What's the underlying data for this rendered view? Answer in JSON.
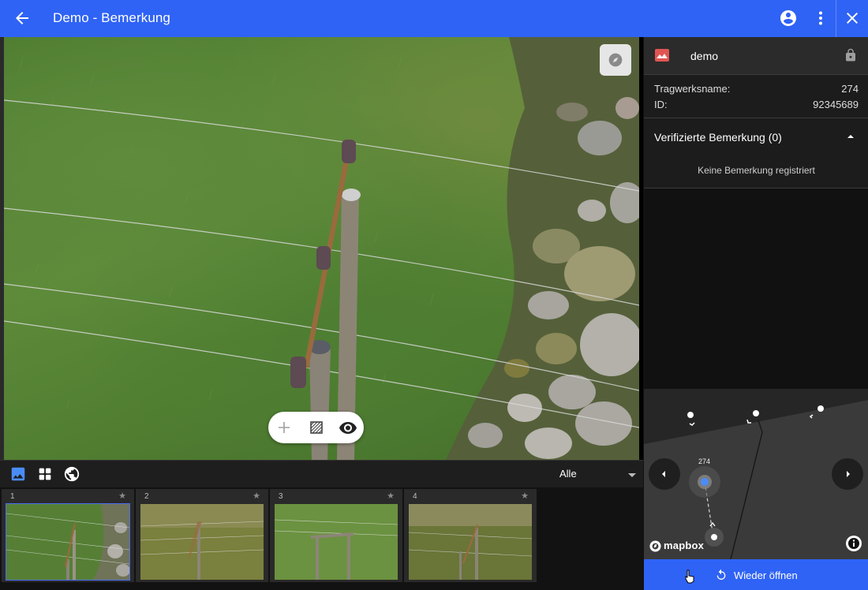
{
  "header": {
    "title": "Demo - Bemerkung",
    "back_icon": "arrow-left-icon",
    "account_icon": "account-circle-icon",
    "more_icon": "more-vertical-icon",
    "close_icon": "close-icon",
    "accent": "#2f63f5"
  },
  "viewer": {
    "compass_icon": "compass-icon",
    "tools": [
      "plus-icon",
      "hatch-pattern-icon",
      "eye-icon"
    ]
  },
  "gallery": {
    "view_icons": [
      "image-icon",
      "grid-icon",
      "globe-icon"
    ],
    "filter_value": "Alle",
    "thumbnails": [
      {
        "number": "1",
        "star": "★",
        "selected": true
      },
      {
        "number": "2",
        "star": "★",
        "selected": false
      },
      {
        "number": "3",
        "star": "★",
        "selected": false
      },
      {
        "number": "4",
        "star": "★",
        "selected": false
      }
    ]
  },
  "panel": {
    "project_name": "demo",
    "project_icon": "image-landscape-icon",
    "lock_icon": "lock-icon",
    "info": [
      {
        "label": "Tragwerksname:",
        "value": "274"
      },
      {
        "label": "ID:",
        "value": "92345689"
      }
    ],
    "section_title": "Verifizierte Bemerkung (0)",
    "section_empty": "Keine Bemerkung registriert",
    "map": {
      "point_label": "274",
      "attribution": "mapbox"
    },
    "action_label": "Wieder öffnen",
    "action_icon": "refresh-icon"
  }
}
